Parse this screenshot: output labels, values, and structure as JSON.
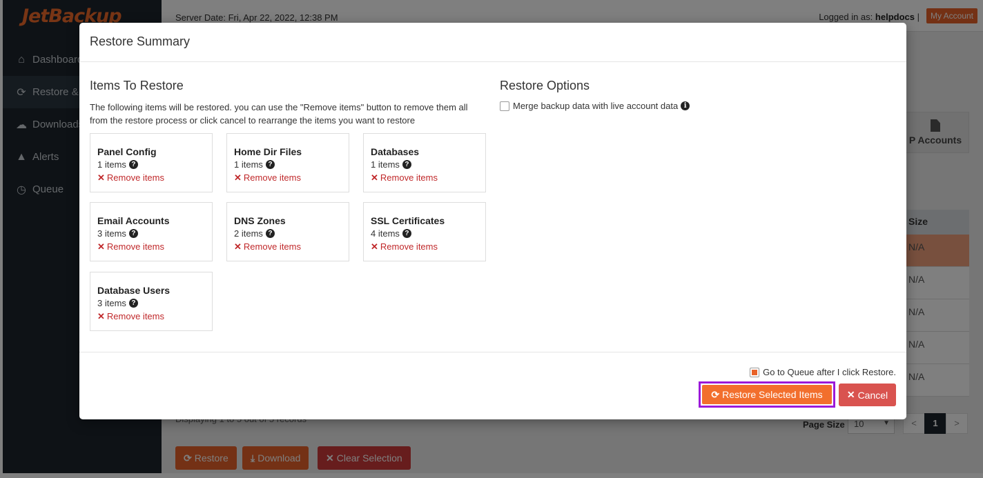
{
  "sidebar": {
    "brand": "JetBackup",
    "items": [
      {
        "label": "Dashboard",
        "icon": "home-icon"
      },
      {
        "label": "Restore &",
        "icon": "refresh-icon"
      },
      {
        "label": "Downloads",
        "icon": "download-icon"
      },
      {
        "label": "Alerts",
        "icon": "warning-icon"
      },
      {
        "label": "Queue",
        "icon": "clock-icon"
      }
    ]
  },
  "topbar": {
    "server_date": "Server Date: Fri, Apr 22, 2022, 12:38 PM",
    "logged_in_prefix": "Logged in as:",
    "username": "helpdocs",
    "separator": "|",
    "my_account": "My Account"
  },
  "background": {
    "tab_label": "P Accounts",
    "column_header": "Size",
    "rows": [
      "N/A",
      "N/A",
      "N/A",
      "N/A",
      "N/A"
    ],
    "displaying": "Displaying 1 to 5 out of 5 records",
    "page_size_label": "Page Size",
    "page_size_value": "10",
    "pager_prev": "<",
    "pager_current": "1",
    "pager_next": ">",
    "buttons": {
      "restore": "Restore",
      "download": "Download",
      "clear_selection": "Clear Selection"
    }
  },
  "modal": {
    "title": "Restore Summary",
    "items_heading": "Items To Restore",
    "intro": "The following items will be restored. you can use the \"Remove items\" button to remove them all from the restore process or click cancel to rearrange the items you want to restore",
    "remove_label": "Remove items",
    "cards": [
      {
        "title": "Panel Config",
        "count": "1 items"
      },
      {
        "title": "Home Dir Files",
        "count": "1 items"
      },
      {
        "title": "Databases",
        "count": "1 items"
      },
      {
        "title": "Email Accounts",
        "count": "3 items"
      },
      {
        "title": "DNS Zones",
        "count": "2 items"
      },
      {
        "title": "SSL Certificates",
        "count": "4 items"
      },
      {
        "title": "Database Users",
        "count": "3 items"
      }
    ],
    "options_heading": "Restore Options",
    "merge_label": "Merge backup data with live account data",
    "merge_checked": false,
    "queue_label": "Go to Queue after I click Restore.",
    "queue_checked": true,
    "restore_button": "Restore Selected Items",
    "cancel_button": "Cancel"
  },
  "colors": {
    "accent": "#f26f2d",
    "danger": "#d9534f",
    "highlight_border": "#9b19d9",
    "sidebar_bg": "#1d252c"
  }
}
